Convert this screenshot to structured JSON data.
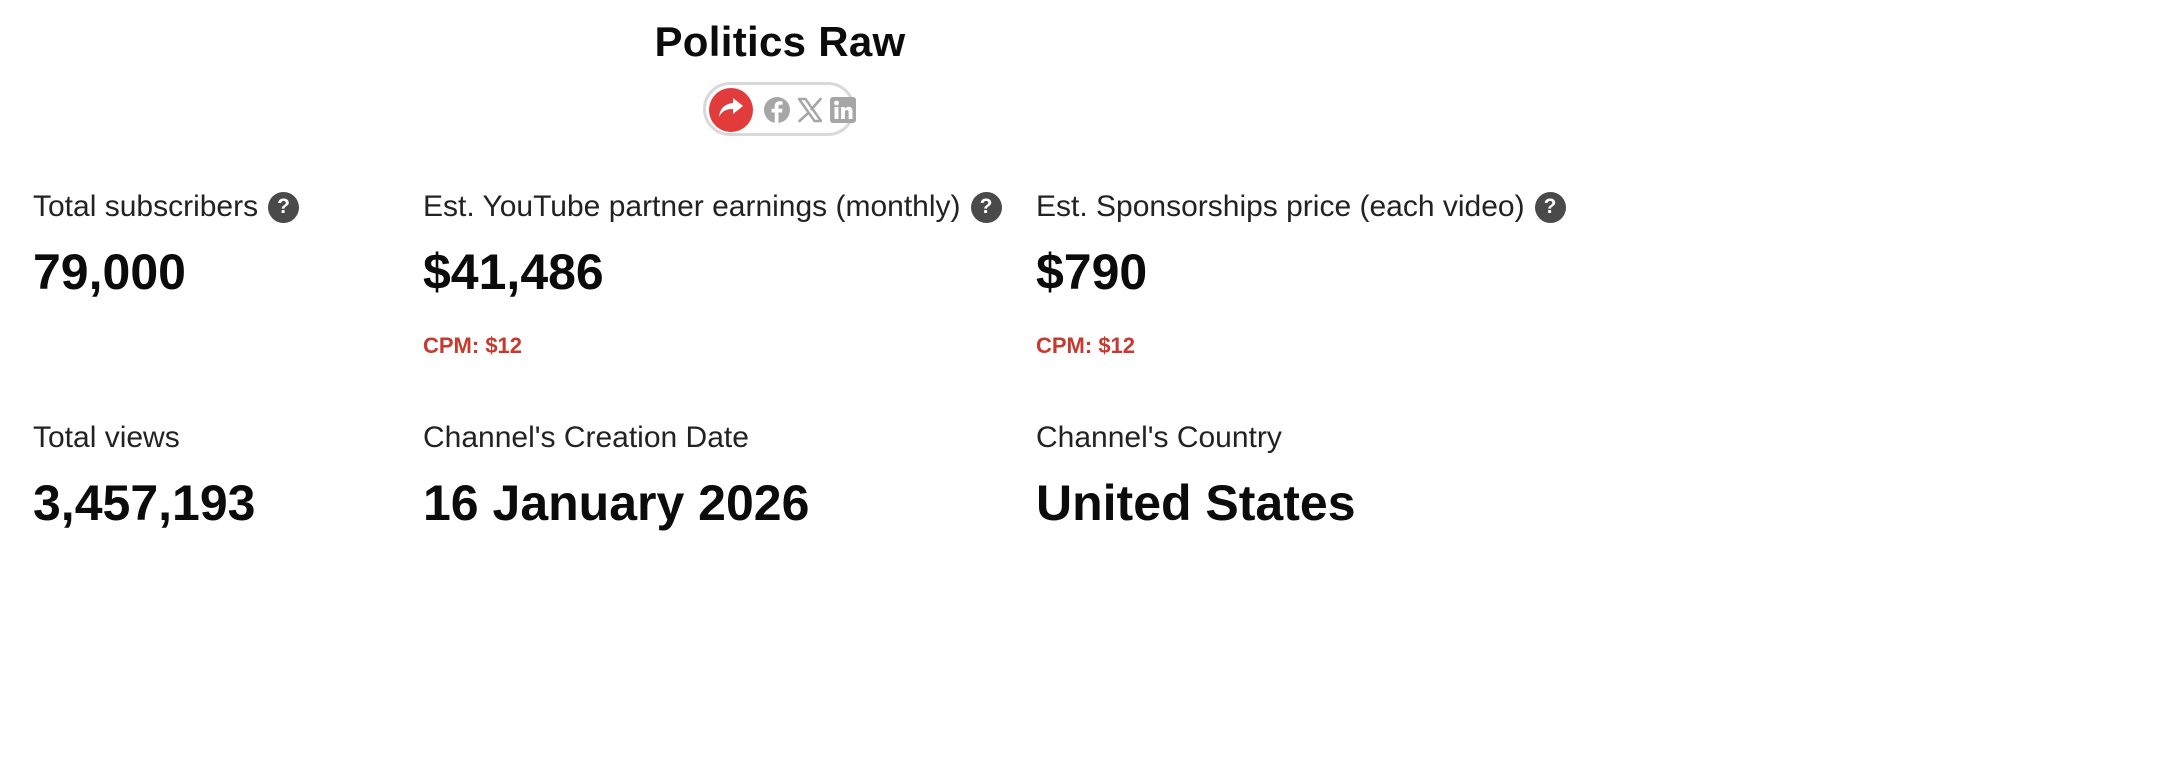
{
  "channel": {
    "title": "Politics Raw"
  },
  "share": {
    "icons": [
      "share-icon",
      "facebook-icon",
      "x-icon",
      "linkedin-icon"
    ],
    "accent_color": "#e23b3b",
    "icon_color": "#a6a6a6"
  },
  "stats": {
    "subscribers": {
      "label": "Total subscribers",
      "value": "79,000",
      "help": "?"
    },
    "earnings": {
      "label": "Est. YouTube partner earnings (monthly)",
      "value": "$41,486",
      "cpm": "CPM: $12",
      "help": "?"
    },
    "sponsorship": {
      "label": "Est. Sponsorships price (each video)",
      "value": "$790",
      "cpm": "CPM: $12",
      "help": "?"
    },
    "views": {
      "label": "Total views",
      "value": "3,457,193"
    },
    "creation_date": {
      "label": "Channel's Creation Date",
      "value": "16 January 2026"
    },
    "country": {
      "label": "Channel's Country",
      "value": "United States"
    }
  },
  "colors": {
    "cpm": "#c8392f",
    "help_badge": "#4a4a4a"
  }
}
